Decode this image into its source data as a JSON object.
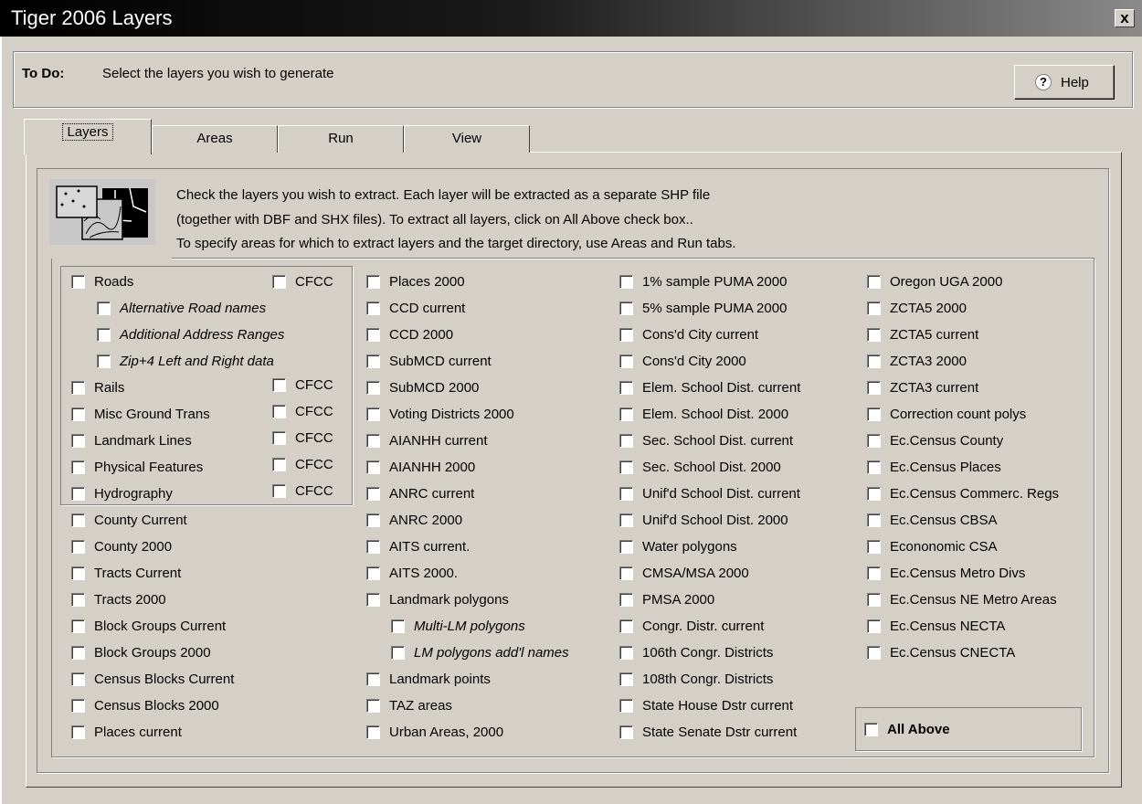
{
  "window": {
    "title": "Tiger 2006 Layers",
    "close_label": "x"
  },
  "todo": {
    "label": "To Do:",
    "text": "Select the layers you wish to generate",
    "help_label": "Help",
    "help_icon": "?"
  },
  "tabs": [
    {
      "label": "Layers",
      "active": true
    },
    {
      "label": "Areas"
    },
    {
      "label": "Run"
    },
    {
      "label": "View"
    }
  ],
  "info": {
    "icon": "layers-map-icon",
    "lines": [
      "Check the layers you wish to extract. Each layer will be extracted as a separate SHP file",
      "(together with DBF and SHX files). To extract all layers, click on All Above check box..",
      "To specify areas for which to extract layers and the target directory, use Areas and Run tabs."
    ]
  },
  "cfcc_label": "CFCC",
  "columns": {
    "col1": [
      "Roads",
      "Alternative Road names",
      "Additional Address Ranges",
      "Zip+4 Left and Right data",
      "Rails",
      "Misc Ground Trans",
      "Landmark Lines",
      "Physical Features",
      "Hydrography",
      "County Current",
      "County 2000",
      "Tracts Current",
      "Tracts 2000",
      "Block Groups Current",
      "Block Groups 2000",
      "Census Blocks Current",
      "Census Blocks 2000",
      "Places current"
    ],
    "col2": [
      "Places 2000",
      "CCD current",
      "CCD 2000",
      "SubMCD current",
      "SubMCD 2000",
      "Voting Districts 2000",
      "AIANHH current",
      "AIANHH 2000",
      "ANRC current",
      "ANRC 2000",
      "AITS current.",
      "AITS 2000.",
      "Landmark polygons",
      "Multi-LM polygons",
      "LM polygons add'l names",
      "Landmark points",
      "TAZ areas",
      "Urban Areas, 2000"
    ],
    "col3": [
      "1% sample PUMA 2000",
      "5% sample PUMA 2000",
      "Cons'd City current",
      "Cons'd City 2000",
      "Elem. School Dist. current",
      "Elem. School Dist. 2000",
      "Sec. School Dist. current",
      "Sec. School Dist. 2000",
      "Unif'd School Dist. current",
      "Unif'd School Dist. 2000",
      "Water polygons",
      "CMSA/MSA 2000",
      "PMSA 2000",
      "Congr. Distr. current",
      "106th Congr. Districts",
      "108th Congr. Districts",
      "State House Dstr current",
      "State Senate Dstr current"
    ],
    "col4": [
      "Oregon UGA 2000",
      "ZCTA5 2000",
      "ZCTA5 current",
      "ZCTA3 2000",
      "ZCTA3 current",
      "Correction count polys",
      "Ec.Census County",
      "Ec.Census Places",
      "Ec.Census Commerc. Regs",
      "Ec.Census CBSA",
      "Econonomic CSA",
      "Ec.Census Metro Divs",
      "Ec.Census NE Metro Areas",
      "Ec.Census NECTA",
      "Ec.Census CNECTA"
    ]
  },
  "all_above_label": "All Above"
}
